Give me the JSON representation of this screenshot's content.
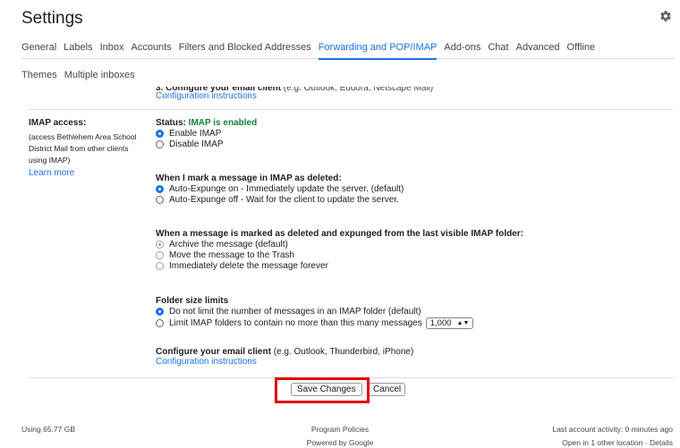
{
  "header": {
    "title": "Settings",
    "settings_icon": "gear-icon"
  },
  "tabs": {
    "row1": [
      "General",
      "Labels",
      "Inbox",
      "Accounts",
      "Filters and Blocked Addresses",
      "Forwarding and POP/IMAP",
      "Add-ons",
      "Chat",
      "Advanced",
      "Offline"
    ],
    "row2": [
      "Themes",
      "Multiple inboxes"
    ],
    "active": "Forwarding and POP/IMAP"
  },
  "top_partial": {
    "bold": "3. Configure your email client",
    "rest": " (e.g. Outlook, Eudora, Netscape Mail)",
    "link": "Configuration instructions"
  },
  "imap": {
    "label": "IMAP access:",
    "desc_lines": [
      "(access Bethlehem Area School",
      "District Mail from other clients",
      "using IMAP)"
    ],
    "learn_more": "Learn more",
    "status_prefix": "Status: ",
    "status_value": "IMAP is enabled",
    "enable": "Enable IMAP",
    "disable": "Disable IMAP"
  },
  "deleted": {
    "head": "When I mark a message in IMAP as deleted:",
    "opt1": "Auto-Expunge on - Immediately update the server. (default)",
    "opt2": "Auto-Expunge off - Wait for the client to update the server."
  },
  "expunged": {
    "head": "When a message is marked as deleted and expunged from the last visible IMAP folder:",
    "opt1": "Archive the message (default)",
    "opt2": "Move the message to the Trash",
    "opt3": "Immediately delete the message forever"
  },
  "folder_limits": {
    "head": "Folder size limits",
    "opt1": "Do not limit the number of messages in an IMAP folder (default)",
    "opt2": "Limit IMAP folders to contain no more than this many messages",
    "select_value": "1,000"
  },
  "configure": {
    "bold": "Configure your email client",
    "rest": " (e.g. Outlook, Thunderbird, iPhone)",
    "link": "Configuration instructions"
  },
  "buttons": {
    "save": "Save Changes",
    "cancel": "Cancel"
  },
  "footer": {
    "storage": "Using 65.77 GB",
    "policies": "Program Policies",
    "powered": "Powered by Google",
    "activity": "Last account activity: 0 minutes ago",
    "other": "Open in 1 other location · Details"
  },
  "colors": {
    "accent": "#1a73e8",
    "enabled_green": "#188038",
    "highlight_red": "#e00000"
  }
}
